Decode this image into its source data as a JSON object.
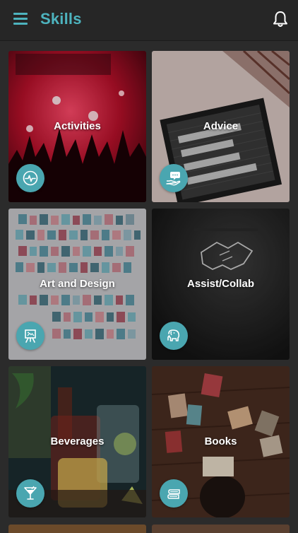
{
  "header": {
    "title": "Skills",
    "menu_icon": "hamburger-menu-icon",
    "notification_icon": "bell-icon"
  },
  "colors": {
    "accent": "#4db3be",
    "icon_button": "#4aa6b0",
    "background": "#2b2b2b",
    "topbar": "#262626"
  },
  "categories": [
    {
      "label": "Activities",
      "icon": "pulse-icon"
    },
    {
      "label": "Advice",
      "icon": "helping-hand-chat-icon"
    },
    {
      "label": "Art and Design",
      "icon": "easel-icon"
    },
    {
      "label": "Assist/Collab",
      "icon": "elephant-icon"
    },
    {
      "label": "Beverages",
      "icon": "cocktail-glass-icon"
    },
    {
      "label": "Books",
      "icon": "books-stack-icon"
    }
  ]
}
